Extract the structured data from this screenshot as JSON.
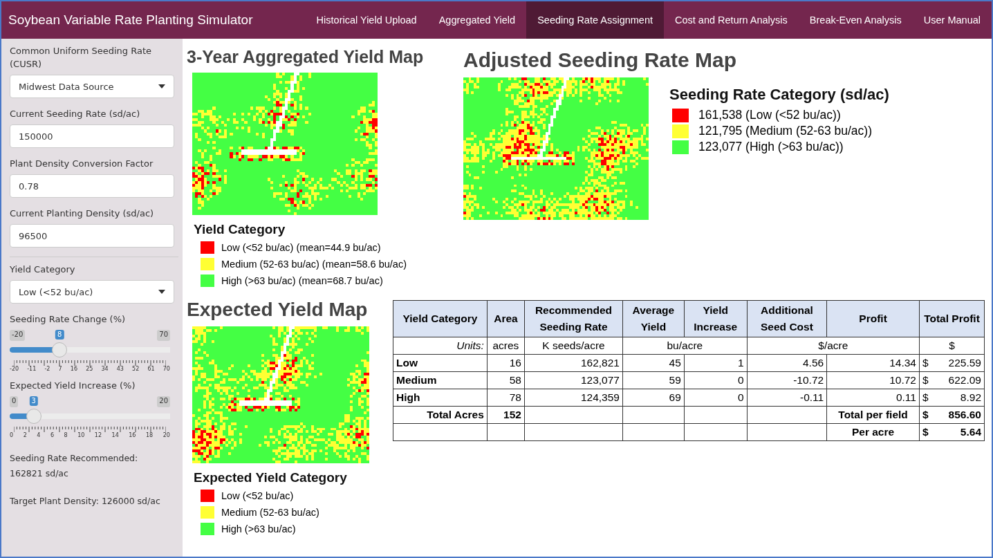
{
  "navbar": {
    "title": "Soybean Variable Rate Planting Simulator",
    "tabs": [
      {
        "label": "Historical Yield Upload",
        "selected": false
      },
      {
        "label": "Aggregated Yield",
        "selected": false
      },
      {
        "label": "Seeding Rate Assignment",
        "selected": true
      },
      {
        "label": "Cost and Return Analysis",
        "selected": false
      },
      {
        "label": "Break-Even Analysis",
        "selected": false
      },
      {
        "label": "User Manual",
        "selected": false
      }
    ]
  },
  "sidebar": {
    "controls": [
      {
        "kind": "select",
        "label": "Common Uniform Seeding Rate (CUSR)",
        "value": "Midwest Data Source"
      },
      {
        "kind": "input",
        "label": "Current Seeding Rate (sd/ac)",
        "value": "150000"
      },
      {
        "kind": "input",
        "label": "Plant Density Conversion Factor",
        "value": "0.78"
      },
      {
        "kind": "input",
        "label": "Current Planting Density (sd/ac)",
        "value": "96500"
      },
      {
        "kind": "divider"
      },
      {
        "kind": "select",
        "label": "Yield Category",
        "value": "Low (<52 bu/ac)"
      },
      {
        "kind": "slider",
        "label": "Seeding Rate Change (%)",
        "min": "-20",
        "max": "70",
        "value": "8",
        "level": 0.311,
        "ticks": [
          "-20",
          "-11",
          "-2",
          "7",
          "16",
          "25",
          "34",
          "43",
          "52",
          "61",
          "70"
        ]
      },
      {
        "kind": "slider",
        "label": "Expected Yield Increase (%)",
        "min": "0",
        "max": "20",
        "value": "3",
        "level": 0.15,
        "ticks": [
          "0",
          "2",
          "4",
          "6",
          "8",
          "10",
          "12",
          "14",
          "16",
          "18",
          "20"
        ]
      },
      {
        "kind": "text",
        "label": "Seeding Rate Recommended:",
        "value": "162821 sd/ac"
      },
      {
        "kind": "text",
        "label": "Target Plant Density: 126000 sd/ac"
      }
    ]
  },
  "aggregated_map": {
    "title": "3-Year Aggregated Yield Map",
    "legend_title": "Yield Category",
    "legend": [
      {
        "label": "Low (<52 bu/ac) (mean=44.9 bu/ac)",
        "color": "#ff0000"
      },
      {
        "label": "Medium (52-63 bu/ac) (mean=58.6 bu/ac)",
        "color": "#ffff33"
      },
      {
        "label": "High (>63 bu/ac) (mean=68.7 bu/ac)",
        "color": "#44ff44"
      }
    ]
  },
  "adjusted_map": {
    "title": "Adjusted Seeding Rate Map",
    "legend_title": "Seeding Rate Category (sd/ac)",
    "legend": [
      {
        "label": "161,538 (Low (<52 bu/ac))",
        "color": "#ff0000"
      },
      {
        "label": "121,795 (Medium (52-63 bu/ac))",
        "color": "#ffff33"
      },
      {
        "label": "123,077 (High (>63 bu/ac))",
        "color": "#44ff44"
      }
    ]
  },
  "expected_map": {
    "title": "Expected Yield Map",
    "legend_title": "Expected Yield Category",
    "legend": [
      {
        "label": "Low (<52 bu/ac)",
        "color": "#ff0000"
      },
      {
        "label": "Medium (52-63 bu/ac)",
        "color": "#ffff33"
      },
      {
        "label": "High (>63 bu/ac)",
        "color": "#44ff44"
      }
    ]
  },
  "table": {
    "columns": [
      "Yield Category",
      "Area",
      "Recommended Seeding Rate",
      "Average Yield",
      "Yield Increase",
      "Additional Seed Cost",
      "Profit",
      "Total Profit"
    ],
    "units": [
      "Units:",
      "acres",
      "K seeds/acre",
      "bu/acre",
      "$/acre",
      "$"
    ],
    "rows": [
      {
        "category": "Low",
        "area": "16",
        "rate": "162,821",
        "avg_yield": "45",
        "increase": "1",
        "seed_cost": "4.56",
        "profit": "14.34",
        "total": {
          "currency": "$",
          "value": "225.59"
        }
      },
      {
        "category": "Medium",
        "area": "58",
        "rate": "123,077",
        "avg_yield": "59",
        "increase": "0",
        "seed_cost": "-10.72",
        "profit": "10.72",
        "total": {
          "currency": "$",
          "value": "622.09"
        }
      },
      {
        "category": "High",
        "area": "78",
        "rate": "124,359",
        "avg_yield": "69",
        "increase": "0",
        "seed_cost": "-0.11",
        "profit": "0.11",
        "total": {
          "currency": "$",
          "value": "8.92"
        }
      }
    ],
    "footer": [
      {
        "label": "Total Acres",
        "area": "152",
        "profit_label": "Total per field",
        "total": {
          "currency": "$",
          "value": "856.60"
        }
      },
      {
        "profit_label": "Per acre",
        "total": {
          "currency": "$",
          "value": "5.64"
        }
      }
    ]
  }
}
